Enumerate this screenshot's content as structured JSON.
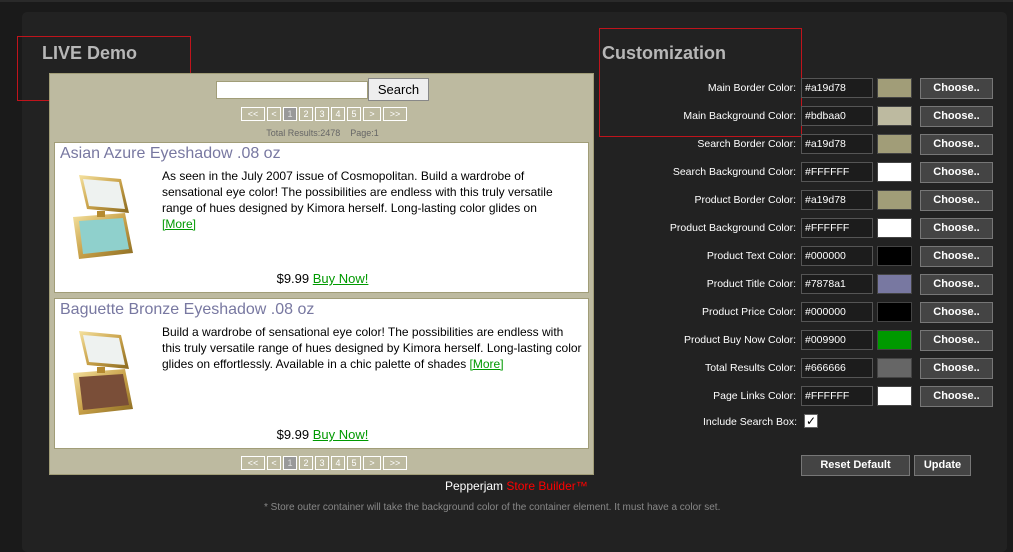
{
  "live_demo": {
    "title": "LIVE Demo",
    "search": {
      "value": "",
      "button": "Search"
    },
    "pager": [
      "<<",
      "<",
      "1",
      "2",
      "3",
      "4",
      "5",
      ">",
      ">>"
    ],
    "total_results": "Total Results:2478",
    "page_info": "Page:1",
    "products": [
      {
        "title": "Asian Azure Eyeshadow .08 oz",
        "description": "As seen in the July 2007 issue of Cosmopolitan. Build a wardrobe of sensational eye color! The possibilities are endless with this truly versatile range of hues designed by Kimora herself. Long-lasting color glides on",
        "more": "[More]",
        "price": "$9.99",
        "buy": "Buy Now!"
      },
      {
        "title": "Baguette Bronze Eyeshadow .08 oz",
        "description": "Build a wardrobe of sensational eye color! The possibilities are endless with this truly versatile range of hues designed by Kimora herself. Long-lasting color glides on effortlessly. Available in a chic palette of shades",
        "more": "[More]",
        "price": "$9.99",
        "buy": "Buy Now!"
      }
    ],
    "credit_prefix": "Pepperjam ",
    "credit_brand": "Store Builder™",
    "note": "* Store outer container will take the background color of the container element. It must have a color set."
  },
  "customization": {
    "title": "Customization",
    "choose_label": "Choose..",
    "rows": [
      {
        "label": "Main Border Color:",
        "value": "#a19d78",
        "swatch": "#a19d78"
      },
      {
        "label": "Main Background Color:",
        "value": "#bdbaa0",
        "swatch": "#bdbaa0"
      },
      {
        "label": "Search Border Color:",
        "value": "#a19d78",
        "swatch": "#a19d78"
      },
      {
        "label": "Search Background Color:",
        "value": "#FFFFFF",
        "swatch": "#FFFFFF"
      },
      {
        "label": "Product Border Color:",
        "value": "#a19d78",
        "swatch": "#a19d78"
      },
      {
        "label": "Product Background Color:",
        "value": "#FFFFFF",
        "swatch": "#FFFFFF"
      },
      {
        "label": "Product Text Color:",
        "value": "#000000",
        "swatch": "#000000"
      },
      {
        "label": "Product Title Color:",
        "value": "#7878a1",
        "swatch": "#7878a1"
      },
      {
        "label": "Product Price Color:",
        "value": "#000000",
        "swatch": "#000000"
      },
      {
        "label": "Product Buy Now Color:",
        "value": "#009900",
        "swatch": "#009900"
      },
      {
        "label": "Total Results Color:",
        "value": "#666666",
        "swatch": "#666666"
      },
      {
        "label": "Page Links Color:",
        "value": "#FFFFFF",
        "swatch": "#FFFFFF"
      }
    ],
    "include_search_label": "Include Search Box:",
    "include_search_checked": true,
    "reset_label": "Reset Default",
    "update_label": "Update"
  }
}
